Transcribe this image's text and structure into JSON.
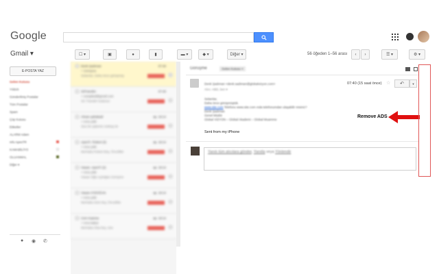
{
  "header": {
    "logo": "Google",
    "search": {
      "value": "",
      "button_icon": "search-icon"
    }
  },
  "toolbar": {
    "app_label": "Gmail ▾",
    "more_label": "Diğer ▾",
    "range": "56 öğeden 1–56 arası"
  },
  "sidebar": {
    "compose_label": "E-POSTA YAZ",
    "items": [
      {
        "label": "Gelen Kutusu",
        "active": true
      },
      {
        "label": "Yıldızlı"
      },
      {
        "label": "Gönderilmiş Postalar"
      },
      {
        "label": "Tüm Postalar"
      },
      {
        "label": "Spam"
      },
      {
        "label": "Çöp Kutusu"
      },
      {
        "label": "Etiketler"
      },
      {
        "label": "ALARM Adam"
      },
      {
        "label": "Info ApesTR",
        "color": "#e8635a"
      },
      {
        "label": "KAMABİLİYO",
        "color": "#f3f3f3"
      },
      {
        "label": "OLUANMAL",
        "color": "#5d6b2a"
      },
      {
        "label": "Diğer ▾"
      }
    ]
  },
  "email_list": [
    {
      "sender": "Denk Şadıman",
      "time": "07:40",
      "subject": "+ Görüşme",
      "snippet": "Selamlar, Daha önce görüşmüş"
    },
    {
      "sender": "SitTransfer",
      "time": "07:40",
      "subject": "+ noreplied@gmail.com",
      "snippet": "Siz Transfer kodunuz"
    },
    {
      "sender": "Ahsan şahabadi",
      "time": "ap. 19:14",
      "subject": "+ Arno yıldı",
      "snippet": "Size bir şişkenin mektup ile"
    },
    {
      "sender": "ApesTr. Robert (3)",
      "time": "ap. 19:14",
      "subject": "+ Arno yıldı",
      "snippet": "Merhaba Robert Bey, Öncelikle"
    },
    {
      "sender": "Hasan. ApesTr (2)",
      "time": "ap. 19:14",
      "subject": "+ Arno yıldı",
      "snippet": "Hasan Oğlu Aydoğan Görüşme"
    },
    {
      "sender": "Hasan AYDOĞAN",
      "time": "ap. 19:14",
      "subject": "+ Arno yıldı",
      "snippet": "Merhaba Sizin bey, Öncelikle"
    },
    {
      "sender": "Cem Kaansa",
      "time": "ap. 19:14",
      "subject": "+ Arno kabut",
      "snippet": "Merhaba Olsa bey, size"
    }
  ],
  "message": {
    "pane_title": "Görüşme",
    "inbox_badge": "Gelen Kutusu ×",
    "sender": "Denk Şadıman",
    "sender_email": "<denk.sadiman@globalvizyon.com>",
    "to_line": "Alıcı: ABD, ben ▾",
    "time": "07:40 (15 saat önce)",
    "body": [
      "Selamlar,",
      "Daha önce görüşmüştük.",
      "Telefonu www.site.com ında telefonumdan ulaşabilir misiniz?",
      "Denk Şadıman",
      "Genel Müdür",
      "Global VİZYON – Global Akademi – Global Muamme"
    ],
    "body_link": "www.site.com",
    "sent_from": "Sent from my iPhone",
    "reply_prompt": "Yanıtı tüm alıcılara gönder",
    "reply_sep1": ", ",
    "reply_label": "Yanıtla",
    "reply_sep2": " veya ",
    "forward_label": "Yönlendir"
  },
  "annotation": {
    "label": "Remove ADS",
    "arrow_color": "#e01010"
  }
}
